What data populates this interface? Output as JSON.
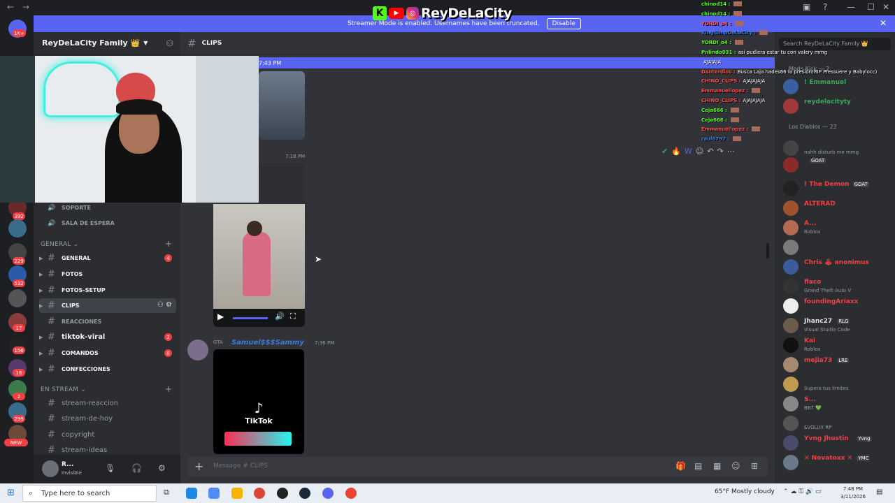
{
  "banner": {
    "text": "Streamer Mode is enabled. Usernames have been truncated.",
    "button": "Disable"
  },
  "overlay_logo": {
    "name": "ReyDeLaCity"
  },
  "server": {
    "name": "ReyDeLaCity Family 👑"
  },
  "rail_badges": [
    "1K+",
    "392",
    "229",
    "532",
    "17",
    "156",
    "16",
    "2",
    "299",
    "NEW"
  ],
  "channels_top": [
    {
      "label": "SOPORTE",
      "icon": "speaker-icon"
    },
    {
      "label": "SALA DE ESPERA",
      "icon": "speaker-icon"
    }
  ],
  "categories": {
    "general": "GENERAL",
    "en_stream": "EN STREAM"
  },
  "channels_general": [
    {
      "label": "GENERAL",
      "badge": "4"
    },
    {
      "label": "FOTOS",
      "badge": ""
    },
    {
      "label": "FOTOS-SETUP",
      "badge": ""
    },
    {
      "label": "CLIPS",
      "badge": ""
    },
    {
      "label": "REACCIONES",
      "badge": ""
    },
    {
      "label": "tiktok-viral",
      "badge": "2"
    },
    {
      "label": "COMANDOS",
      "badge": "8"
    },
    {
      "label": "CONFECCIONES",
      "badge": ""
    }
  ],
  "channels_stream": [
    "stream-reaccion",
    "stream-de-hoy",
    "copyright",
    "stream-ideas"
  ],
  "user": {
    "name": "R...",
    "status": "Invisible"
  },
  "channel_header": {
    "name": "CLIPS"
  },
  "main": {
    "new_bar_time": "7:43 PM",
    "msg1_time": "7:28 PM",
    "msg2_tag": "GTA",
    "msg2_author": "Samuel$$$Sammy",
    "msg2_time": "7:36 PM",
    "tiktok": "TikTok",
    "composer_placeholder": "Message # CLIPS"
  },
  "members": {
    "search_placeholder": "Search ReyDeLaCity Family 👑",
    "groups": [
      "Mods Kick — 2",
      "Los Diablos — 22"
    ],
    "list": [
      {
        "name": "! Emmanuel",
        "activity": "",
        "color": "#3ba55d",
        "tag": ""
      },
      {
        "name": "reydelacityty",
        "activity": "",
        "color": "#3ba55d",
        "tag": ""
      },
      {
        "name": "",
        "activity": "nahh disturb me mmg",
        "color": "#949ba4",
        "tag": ""
      },
      {
        "name": "",
        "activity": "",
        "color": "#949ba4",
        "tag": "GOAT"
      },
      {
        "name": "! The Demon",
        "activity": "",
        "color": "#f23f43",
        "tag": "GOAT"
      },
      {
        "name": "ALTERAD",
        "activity": "",
        "color": "#f23f43",
        "tag": ""
      },
      {
        "name": "A...",
        "activity": "Roblox",
        "color": "#f23f43",
        "tag": ""
      },
      {
        "name": "",
        "activity": "",
        "color": "#949ba4",
        "tag": ""
      },
      {
        "name": "Chris 🕹 anonimus",
        "activity": "",
        "color": "#f23f43",
        "tag": ""
      },
      {
        "name": "flaco",
        "activity": "Grand Theft Auto V",
        "color": "#f23f43",
        "tag": ""
      },
      {
        "name": "foundingAriaxx",
        "activity": "",
        "color": "#f23f43",
        "tag": ""
      },
      {
        "name": "Jhanc27",
        "activity": "Visual Studio Code",
        "color": "#dbdee1",
        "tag": "RLG"
      },
      {
        "name": "Kai",
        "activity": "Roblox",
        "color": "#f23f43",
        "tag": ""
      },
      {
        "name": "mejia73",
        "activity": "",
        "color": "#f23f43",
        "tag": "LRE"
      },
      {
        "name": "",
        "activity": "Supera tus limites",
        "color": "#949ba4",
        "tag": ""
      },
      {
        "name": "S...",
        "activity": "BBT 💚",
        "color": "#f23f43",
        "tag": ""
      },
      {
        "name": "",
        "activity": "EVOLUX RP",
        "color": "#949ba4",
        "tag": ""
      },
      {
        "name": "Yvng Jhustin",
        "activity": "",
        "color": "#f23f43",
        "tag": "Yvng"
      },
      {
        "name": "✕ Novatoxx ✕",
        "activity": "",
        "color": "#f23f43",
        "tag": "YMC"
      }
    ]
  },
  "chat": [
    {
      "user": "chinod14 :",
      "msg": "",
      "color": "#53fc18"
    },
    {
      "user": "chinod14 :",
      "msg": "",
      "color": "#53fc18"
    },
    {
      "user": "YORDI_o4 :",
      "msg": "",
      "color": "#ff4c4c"
    },
    {
      "user": "KingSimpDeLaCity :",
      "msg": "",
      "color": "#3b7bdb"
    },
    {
      "user": "YORDI_o4 :",
      "msg": "",
      "color": "#53fc18"
    },
    {
      "user": "Pnlindo031 :",
      "msg": "asi pudiera estar tu con valery mmg",
      "color": "#53fc18"
    },
    {
      "user": "",
      "msg": "AJAJAJA",
      "color": "#ffffff"
    },
    {
      "user": "Danterdios :",
      "msg": "Busca Laja hades66 la presión(RIP Pressuere y Babylocc)",
      "color": "#ff4c4c"
    },
    {
      "user": "CHINO_CLIPS :",
      "msg": "AJAJAJAJA",
      "color": "#ff4c4c"
    },
    {
      "user": "Emmanuellopez :",
      "msg": "",
      "color": "#ff4c4c"
    },
    {
      "user": "CHINO_CLIPS :",
      "msg": "AJAJAJAJA",
      "color": "#ff4c4c"
    },
    {
      "user": "Ceja666 :",
      "msg": "",
      "color": "#53fc18"
    },
    {
      "user": "Ceja666 :",
      "msg": "",
      "color": "#53fc18"
    },
    {
      "user": "Emmanuellopez :",
      "msg": "",
      "color": "#ff4c4c"
    },
    {
      "user": "raul6797 :",
      "msg": "",
      "color": "#3b7bdb"
    }
  ],
  "taskbar": {
    "search_placeholder": "Type here to search",
    "weather": "65°F  Mostly cloudy",
    "time": "7:48 PM",
    "date": "3/11/2026"
  }
}
